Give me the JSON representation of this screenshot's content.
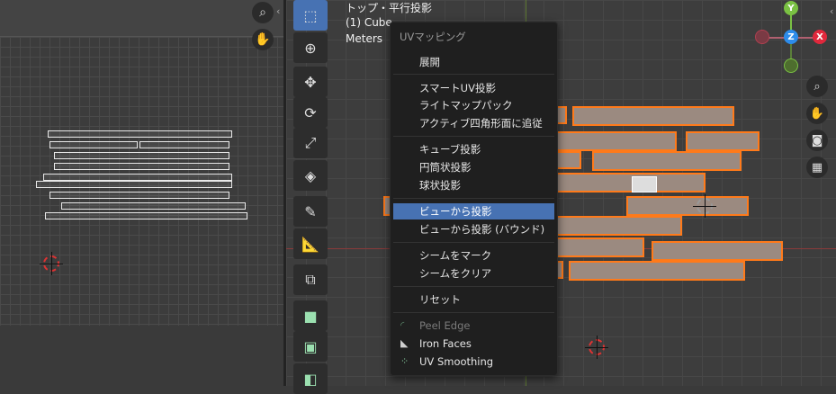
{
  "viewport": {
    "view_name": "トップ・平行投影",
    "object_label": "(1) Cube",
    "units": "Meters"
  },
  "gizmo": {
    "y": "Y",
    "z": "Z",
    "x": "X"
  },
  "menu": {
    "title": "UVマッピング",
    "items": [
      {
        "label": "展開"
      },
      {
        "label": "スマートUV投影"
      },
      {
        "label": "ライトマップパック"
      },
      {
        "label": "アクティブ四角形面に追従"
      },
      {
        "label": "キューブ投影"
      },
      {
        "label": "円筒状投影"
      },
      {
        "label": "球状投影"
      },
      {
        "label": "ビューから投影"
      },
      {
        "label": "ビューから投影 (バウンド)"
      },
      {
        "label": "シームをマーク"
      },
      {
        "label": "シームをクリア"
      },
      {
        "label": "リセット"
      },
      {
        "label": "Peel Edge"
      },
      {
        "label": "Iron Faces"
      },
      {
        "label": "UV Smoothing"
      }
    ]
  },
  "colors": {
    "highlight": "#4772b3",
    "selection_outline": "#ff7a1a",
    "axis_x": "#e0283c",
    "axis_y": "#7ac143",
    "axis_z": "#2d8ceb"
  }
}
